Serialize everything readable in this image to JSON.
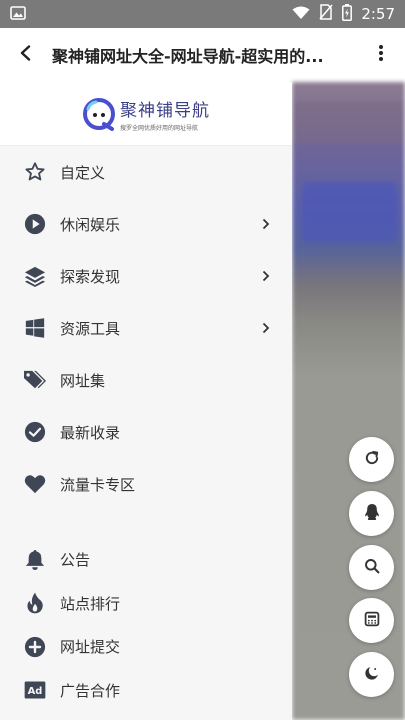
{
  "status_bar": {
    "time": "2:57",
    "icons": [
      "image-icon",
      "wifi-icon",
      "no-sim-icon",
      "battery-icon"
    ]
  },
  "app_bar": {
    "title": "聚神铺网址大全-网址导航-超实用的...",
    "back_icon": "back-arrow-icon",
    "more_icon": "more-vert-icon"
  },
  "drawer": {
    "logo": {
      "title": "聚神铺导航",
      "subtitle": "搜罗全网优质好用的网址导航"
    },
    "items": [
      {
        "label": "自定义",
        "icon": "star-outline-icon",
        "has_submenu": false
      },
      {
        "label": "休闲娱乐",
        "icon": "play-circle-icon",
        "has_submenu": true
      },
      {
        "label": "探索发现",
        "icon": "layers-icon",
        "has_submenu": true
      },
      {
        "label": "资源工具",
        "icon": "windows-icon",
        "has_submenu": true
      },
      {
        "label": "网址集",
        "icon": "tags-icon",
        "has_submenu": false
      },
      {
        "label": "最新收录",
        "icon": "check-circle-icon",
        "has_submenu": false
      },
      {
        "label": "流量卡专区",
        "icon": "heart-icon",
        "has_submenu": false
      }
    ],
    "secondary_items": [
      {
        "label": "公告",
        "icon": "bell-icon"
      },
      {
        "label": "站点排行",
        "icon": "fire-icon"
      },
      {
        "label": "网址提交",
        "icon": "plus-circle-icon"
      },
      {
        "label": "广告合作",
        "icon": "ad-icon"
      }
    ]
  },
  "fabs": [
    {
      "name": "refresh",
      "icon": "refresh-icon"
    },
    {
      "name": "qq",
      "icon": "qq-icon"
    },
    {
      "name": "search",
      "icon": "search-icon"
    },
    {
      "name": "calculator",
      "icon": "calculator-icon"
    },
    {
      "name": "night-mode",
      "icon": "moon-icon"
    }
  ],
  "colors": {
    "status_bar": "#7a7a7a",
    "drawer_bg": "#f6f6f6",
    "icon": "#3f4655",
    "logo_text": "#3a3f86"
  }
}
